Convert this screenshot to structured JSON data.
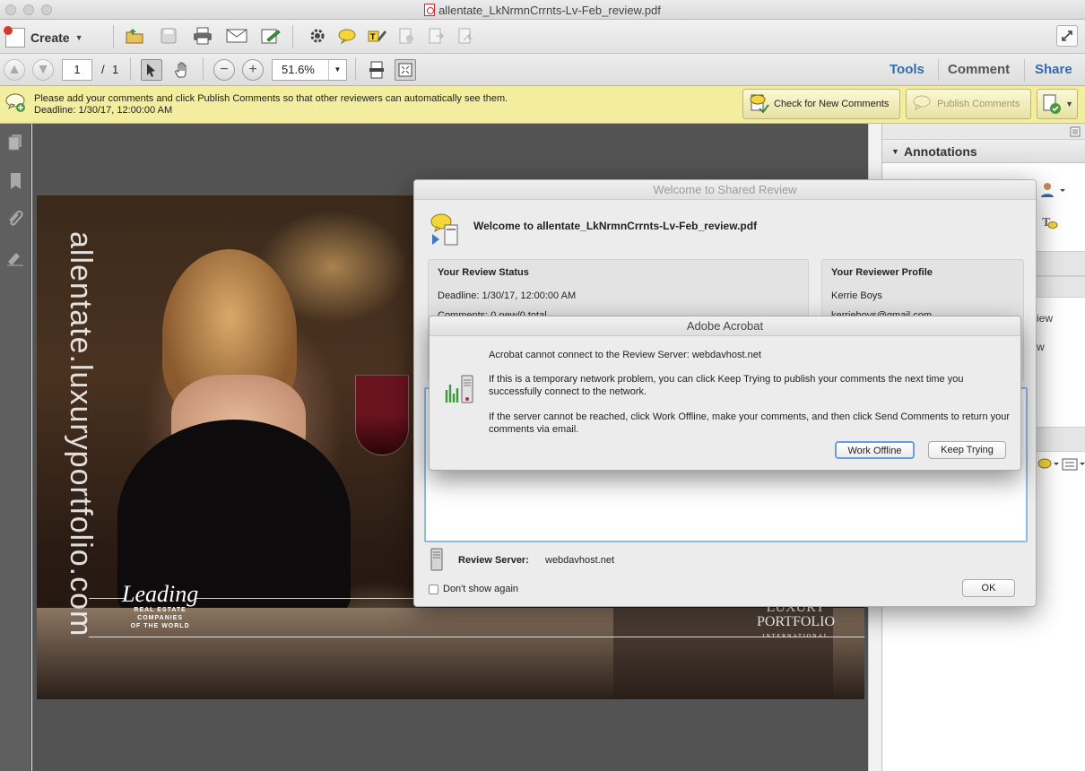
{
  "window": {
    "title": "allentate_LkNrmnCrrnts-Lv-Feb_review.pdf"
  },
  "toolbar": {
    "create_label": "Create",
    "page_current": "1",
    "page_sep": "/",
    "page_total": "1",
    "zoom": "51.6%",
    "tabs": [
      "Tools",
      "Comment",
      "Share"
    ]
  },
  "notice": {
    "line1": "Please add your comments and click Publish Comments so that other reviewers can automatically see them.",
    "line2": "Deadline: 1/30/17, 12:00:00 AM",
    "check_label": "Check for New Comments",
    "publish_label": "Publish Comments"
  },
  "document": {
    "vertical_text": "allentate.luxuryportfolio.com",
    "leading_title": "Leading",
    "leading_sub": [
      "REAL ESTATE",
      "COMPANIES",
      "OF THE WORLD"
    ],
    "lux_lines": [
      "LUXURY",
      "PORTFOLIO",
      "INTERNATIONAL"
    ]
  },
  "right_pane": {
    "annotations_label": "Annotations",
    "partial_1": "iew",
    "partial_2": "w"
  },
  "shared_review": {
    "title": "Welcome to Shared Review",
    "welcome": "Welcome to allentate_LkNrmnCrrnts-Lv-Feb_review.pdf",
    "status_heading": "Your Review Status",
    "deadline": "Deadline: 1/30/17, 12:00:00 AM",
    "comments": "Comments: 0 new/0 total",
    "profile_heading": "Your Reviewer Profile",
    "profile_name": "Kerrie Boys",
    "profile_email": "kerrieboys@gmail.com",
    "server_label": "Review Server:",
    "server_value": "webdavhost.net",
    "dont_show": "Don't show again",
    "ok_label": "OK"
  },
  "alert": {
    "title": "Adobe Acrobat",
    "line1": "Acrobat cannot connect to the Review Server: webdavhost.net",
    "line2": "If this is a temporary network problem, you can click Keep Trying to publish your comments the next time you successfully connect to the network.",
    "line3": "If the server cannot be reached, click Work Offline, make your comments,  and then click Send Comments to return your comments via email.",
    "work_offline": "Work Offline",
    "keep_trying": "Keep Trying"
  },
  "colors": {
    "accent": "#3a73b0",
    "notice_bg": "#f3eda0",
    "doc_bg": "#535353"
  }
}
